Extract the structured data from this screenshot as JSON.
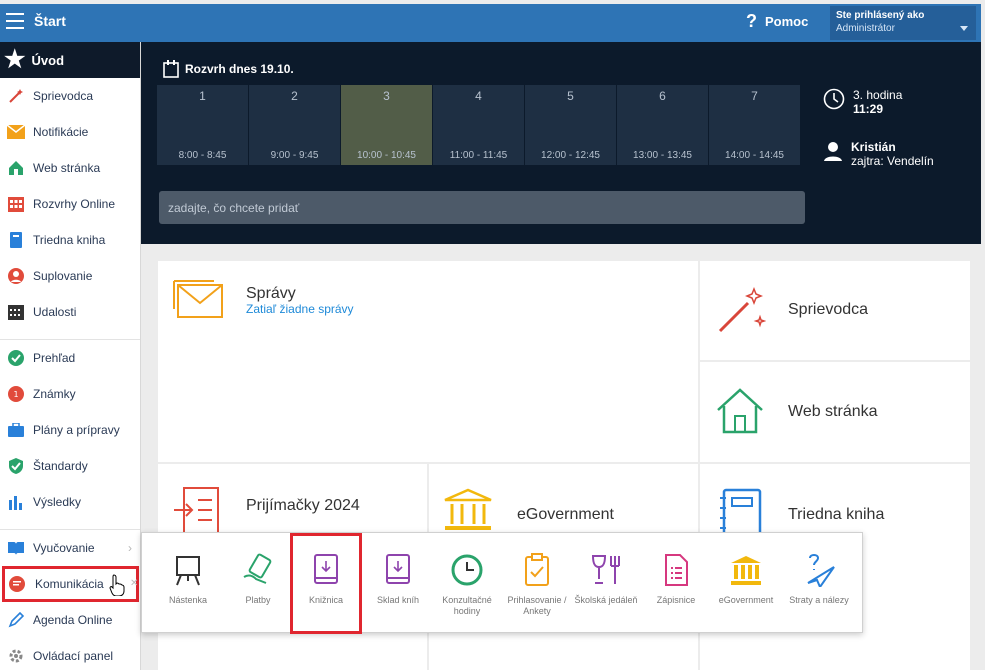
{
  "app": {
    "title": "Štart",
    "help_label": "Pomoc",
    "user_label": "Ste prihlásený ako",
    "user_name": "Administrátor"
  },
  "sidebar": {
    "header": "Úvod",
    "items": [
      {
        "label": "Sprievodca",
        "icon": "magic-wand-icon"
      },
      {
        "label": "Notifikácie",
        "icon": "envelope-icon"
      },
      {
        "label": "Web stránka",
        "icon": "house-icon"
      },
      {
        "label": "Rozvrhy Online",
        "icon": "calendar-grid-icon"
      },
      {
        "label": "Triedna kniha",
        "icon": "notebook-icon"
      },
      {
        "label": "Suplovanie",
        "icon": "person-icon"
      },
      {
        "label": "Udalosti",
        "icon": "calendar-icon"
      },
      {
        "label": "Prehľad",
        "icon": "check-circle-icon"
      },
      {
        "label": "Známky",
        "icon": "grade-icon"
      },
      {
        "label": "Plány a prípravy",
        "icon": "briefcase-icon"
      },
      {
        "label": "Štandardy",
        "icon": "shield-check-icon"
      },
      {
        "label": "Výsledky",
        "icon": "bar-chart-icon"
      },
      {
        "label": "Vyučovanie",
        "icon": "book-open-icon"
      },
      {
        "label": "Komunikácia",
        "icon": "chat-icon"
      },
      {
        "label": "Agenda Online",
        "icon": "pencil-icon"
      },
      {
        "label": "Ovládací panel",
        "icon": "gear-icon"
      }
    ]
  },
  "schedule": {
    "title": "Rozvrh dnes 19.10.",
    "periods": [
      {
        "n": "1",
        "t": "8:00 - 8:45"
      },
      {
        "n": "2",
        "t": "9:00 - 9:45"
      },
      {
        "n": "3",
        "t": "10:00 - 10:45"
      },
      {
        "n": "4",
        "t": "11:00 - 11:45"
      },
      {
        "n": "5",
        "t": "12:00 - 12:45"
      },
      {
        "n": "6",
        "t": "13:00 - 13:45"
      },
      {
        "n": "7",
        "t": "14:00 - 14:45"
      }
    ],
    "search_placeholder": "zadajte, čo chcete pridať",
    "current_hour": "3. hodina",
    "current_time": "11:29",
    "nameday_today": "Kristián",
    "nameday_tomorrow": "zajtra: Vendelín"
  },
  "tiles": {
    "spravy": "Správy",
    "spravy_sub": "Zatiaľ žiadne správy",
    "sprievodca": "Sprievodca",
    "web": "Web stránka",
    "prijimacky": "Prijímačky 2024",
    "egov": "eGovernment",
    "triedna": "Triedna kniha"
  },
  "popup": {
    "items": [
      {
        "label": "Nástenka",
        "icon": "easel-icon"
      },
      {
        "label": "Platby",
        "icon": "money-hand-icon"
      },
      {
        "label": "Knižnica",
        "icon": "book-download-icon"
      },
      {
        "label": "Sklad kníh",
        "icon": "book-stock-icon"
      },
      {
        "label": "Konzultačné hodiny",
        "icon": "clock-circle-icon"
      },
      {
        "label": "Prihlasovanie / Ankety",
        "icon": "clipboard-check-icon"
      },
      {
        "label": "Školská jedáleň",
        "icon": "dining-icon"
      },
      {
        "label": "Zápisnice",
        "icon": "document-list-icon"
      },
      {
        "label": "eGovernment",
        "icon": "government-building-icon"
      },
      {
        "label": "Straty a nálezy",
        "icon": "lost-found-icon"
      }
    ]
  }
}
